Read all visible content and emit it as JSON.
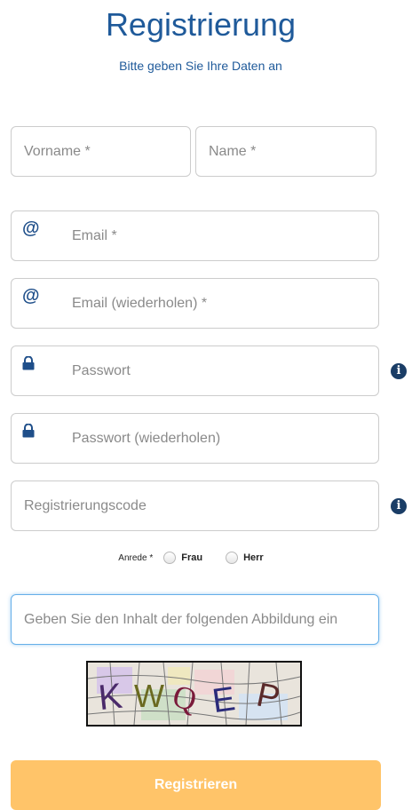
{
  "header": {
    "title": "Registrierung",
    "subtitle": "Bitte geben Sie Ihre Daten an"
  },
  "form": {
    "vorname_placeholder": "Vorname *",
    "name_placeholder": "Name *",
    "email_placeholder": "Email *",
    "email_repeat_placeholder": "Email (wiederholen) *",
    "password_placeholder": "Passwort",
    "password_repeat_placeholder": "Passwort (wiederholen)",
    "regcode_placeholder": "Registrierungscode",
    "at_symbol": "@",
    "info_symbol": "i",
    "salutation": {
      "label": "Anrede *",
      "options": [
        "Frau",
        "Herr"
      ]
    },
    "captcha_placeholder": "Geben Sie den Inhalt der folgenden Abbildung ein",
    "captcha_text": "KWQEP",
    "submit_label": "Registrieren"
  },
  "icons": {
    "email": "at-icon",
    "password": "lock-icon",
    "info": "info-circle-icon"
  },
  "colors": {
    "title": "#1f5a9a",
    "icon": "#1f4f8a",
    "button": "#ffc469",
    "focus_border": "#66afe9"
  }
}
